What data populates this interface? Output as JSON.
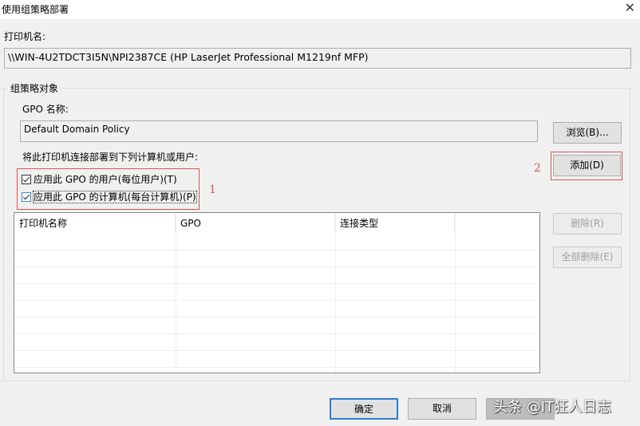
{
  "window": {
    "title": "使用组策略部署",
    "close_icon": "close-icon"
  },
  "printer": {
    "label": "打印机名:",
    "value": "\\\\WIN-4U2TDCT3I5N\\NPI2387CE (HP LaserJet Professional M1219nf MFP)"
  },
  "group": {
    "label": "组策略对象",
    "gpo_label": "GPO 名称:",
    "gpo_value": "Default Domain Policy",
    "browse": "浏览(B)...",
    "deploy_label": "将此打印机连接部署到下列计算机或用户:",
    "add": "添加(D)",
    "check_users": "应用此 GPO 的用户(每位用户)(T)",
    "check_computers": "应用此 GPO 的计算机(每台计算机)(P)",
    "check_users_checked": true,
    "check_computers_checked": true,
    "remove": "删除(R)",
    "remove_all": "全部删除(E)"
  },
  "list": {
    "columns": [
      "打印机名称",
      "GPO",
      "连接类型"
    ]
  },
  "annotations": {
    "one": "1",
    "two": "2"
  },
  "footer": {
    "ok": "确定",
    "cancel": "取消"
  },
  "watermark": "头条 @IT狂人日志"
}
